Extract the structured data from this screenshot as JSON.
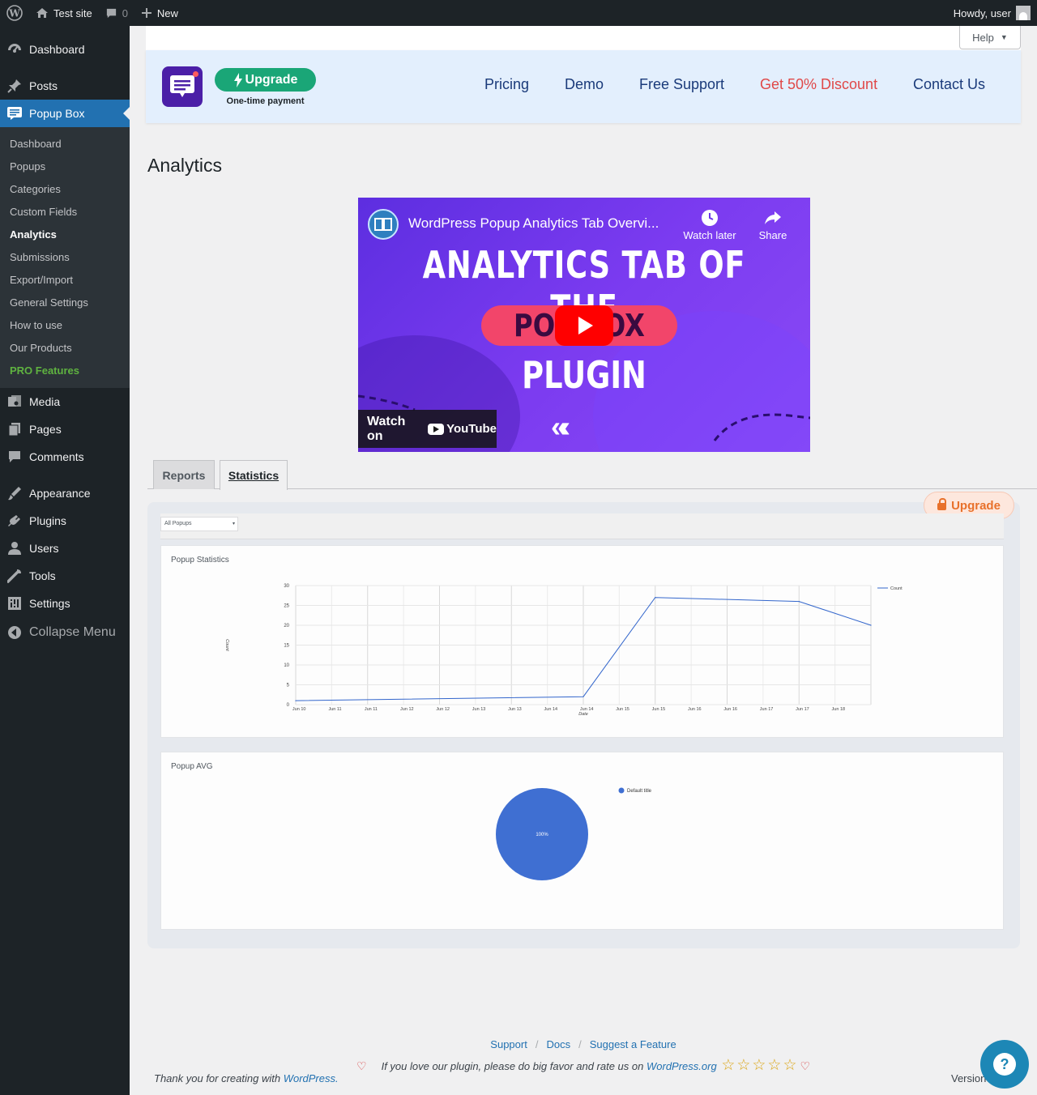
{
  "adminbar": {
    "site_name": "Test site",
    "comments_count": "0",
    "new_label": "New",
    "greeting": "Howdy, user"
  },
  "sidebar": {
    "top": [
      {
        "label": "Dashboard",
        "icon": "dashboard-icon"
      },
      {
        "label": "Posts",
        "icon": "pushpin-icon"
      },
      {
        "label": "Popup Box",
        "icon": "popup-box-icon"
      }
    ],
    "submenu": [
      {
        "label": "Dashboard"
      },
      {
        "label": "Popups"
      },
      {
        "label": "Categories"
      },
      {
        "label": "Custom Fields"
      },
      {
        "label": "Analytics"
      },
      {
        "label": "Submissions"
      },
      {
        "label": "Export/Import"
      },
      {
        "label": "General Settings"
      },
      {
        "label": "How to use"
      },
      {
        "label": "Our Products"
      },
      {
        "label": "PRO Features"
      }
    ],
    "bottom": [
      {
        "label": "Media",
        "icon": "media-icon"
      },
      {
        "label": "Pages",
        "icon": "pages-icon"
      },
      {
        "label": "Comments",
        "icon": "comments-icon"
      },
      {
        "label": "Appearance",
        "icon": "appearance-icon"
      },
      {
        "label": "Plugins",
        "icon": "plugins-icon"
      },
      {
        "label": "Users",
        "icon": "users-icon"
      },
      {
        "label": "Tools",
        "icon": "tools-icon"
      },
      {
        "label": "Settings",
        "icon": "settings-icon"
      },
      {
        "label": "Collapse Menu",
        "icon": "collapse-icon"
      }
    ]
  },
  "help_tab": "Help",
  "banner": {
    "upgrade_label": "Upgrade",
    "one_time": "One-time payment",
    "nav": [
      "Pricing",
      "Demo",
      "Free Support",
      "Get 50% Discount",
      "Contact Us"
    ]
  },
  "page_title": "Analytics",
  "video": {
    "title": "WordPress Popup Analytics Tab Overvi...",
    "watch_later": "Watch later",
    "share": "Share",
    "line1": "ANALYTICS TAB OF THE",
    "line2": "POP BOX",
    "line3": "PLUGIN",
    "watch_on": "Watch on",
    "youtube": "YouTube"
  },
  "tabs": [
    "Reports",
    "Statistics"
  ],
  "upgrade_badge": "Upgrade",
  "filter": {
    "selected": "All Popups"
  },
  "stats_card_title": "Popup Statistics",
  "avg_card_title": "Popup AVG",
  "colors": {
    "accent": "#2271b1",
    "line": "#3366cc",
    "pie": "#3f6fd2",
    "upgrade_green": "#1aa677",
    "discount_red": "#e04848"
  },
  "chart_data": [
    {
      "type": "line",
      "title": "Popup Statistics",
      "xlabel": "Date",
      "ylabel": "Count",
      "x": [
        "Jun 10",
        "Jun 11",
        "Jun 11",
        "Jun 12",
        "Jun 12",
        "Jun 13",
        "Jun 13",
        "Jun 14",
        "Jun 14",
        "Jun 15",
        "Jun 15",
        "Jun 16",
        "Jun 16",
        "Jun 17",
        "Jun 17",
        "Jun 18"
      ],
      "point_x": [
        "Jun 10",
        "Jun 14",
        "Jun 15",
        "Jun 17",
        "Jun 18"
      ],
      "series": [
        {
          "name": "Count",
          "values": [
            1,
            2,
            27,
            26,
            20
          ]
        }
      ],
      "point_x_index": [
        0,
        8,
        10,
        14,
        16
      ],
      "ylim": [
        0,
        30
      ],
      "yticks": [
        0,
        5,
        10,
        15,
        20,
        25,
        30
      ],
      "legend": "right",
      "grid": true
    },
    {
      "type": "pie",
      "title": "Popup AVG",
      "slices": [
        {
          "label": "Default title",
          "value": 100,
          "text": "100%"
        }
      ],
      "legend": "right"
    }
  ],
  "footer": {
    "links": [
      "Support",
      "Docs",
      "Suggest a Feature"
    ],
    "love_text": "If you love our plugin, please do big favor and rate us on",
    "love_link": "WordPress.org",
    "stars": "☆☆☆☆☆",
    "thanks": "Thank you for creating with",
    "thanks_link": "WordPress.",
    "version": "Version"
  }
}
